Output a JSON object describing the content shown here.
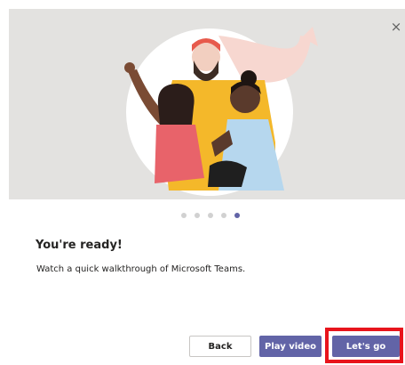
{
  "dialog": {
    "title": "You're ready!",
    "subtitle": "Watch a quick walkthrough of Microsoft Teams.",
    "close_glyph": "×"
  },
  "carousel": {
    "total_steps": 5,
    "active_step": 5
  },
  "buttons": {
    "back_label": "Back",
    "play_label": "Play video",
    "go_label": "Let's go"
  },
  "colors": {
    "accent": "#6264a7",
    "highlight": "#e8141c",
    "hero_background": "#e3e2e0"
  },
  "icons": {
    "close": "close-icon"
  }
}
